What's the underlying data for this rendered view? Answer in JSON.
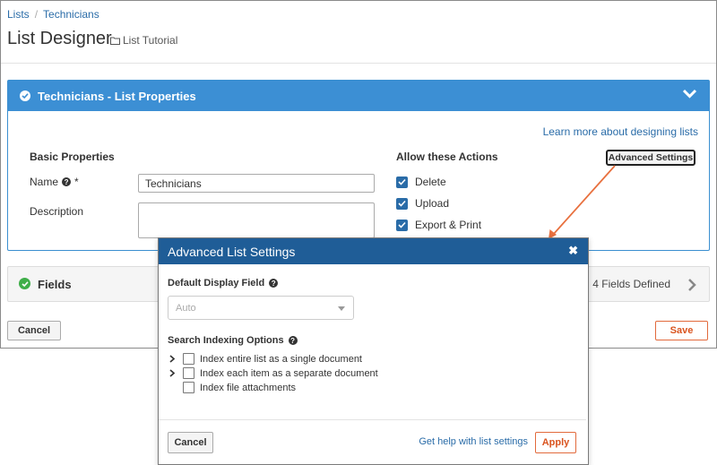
{
  "breadcrumb": {
    "items": [
      "Lists",
      "Technicians"
    ],
    "separator": "/"
  },
  "page": {
    "title": "List Designer",
    "folder": "List Tutorial"
  },
  "properties_panel": {
    "title": "Technicians - List Properties",
    "learn_link": "Learn more about designing lists",
    "basic_properties_label": "Basic Properties",
    "name_label": "Name",
    "required_marker": "*",
    "name_value": "Technicians",
    "description_label": "Description",
    "description_value": "",
    "actions_label": "Allow these Actions",
    "actions": [
      {
        "label": "Delete",
        "checked": true
      },
      {
        "label": "Upload",
        "checked": true
      },
      {
        "label": "Export & Print",
        "checked": true
      }
    ],
    "advanced_button": "Advanced Settings"
  },
  "fields_panel": {
    "title": "Fields",
    "summary": "4 Fields Defined"
  },
  "footer": {
    "cancel": "Cancel",
    "save": "Save"
  },
  "modal": {
    "title": "Advanced List Settings",
    "default_display_label": "Default Display Field",
    "default_display_value": "Auto",
    "search_indexing_label": "Search Indexing Options",
    "options": [
      {
        "label": "Index entire list as a single document",
        "expandable": true,
        "checked": false
      },
      {
        "label": "Index each item as a separate document",
        "expandable": true,
        "checked": false
      },
      {
        "label": "Index file attachments",
        "expandable": false,
        "checked": false
      }
    ],
    "cancel": "Cancel",
    "help_link": "Get help with list settings",
    "apply": "Apply"
  },
  "colors": {
    "panel_header": "#3c8fd4",
    "modal_header": "#1f5d97",
    "accent_orange": "#e26a3c",
    "arrow": "#e8703e"
  }
}
